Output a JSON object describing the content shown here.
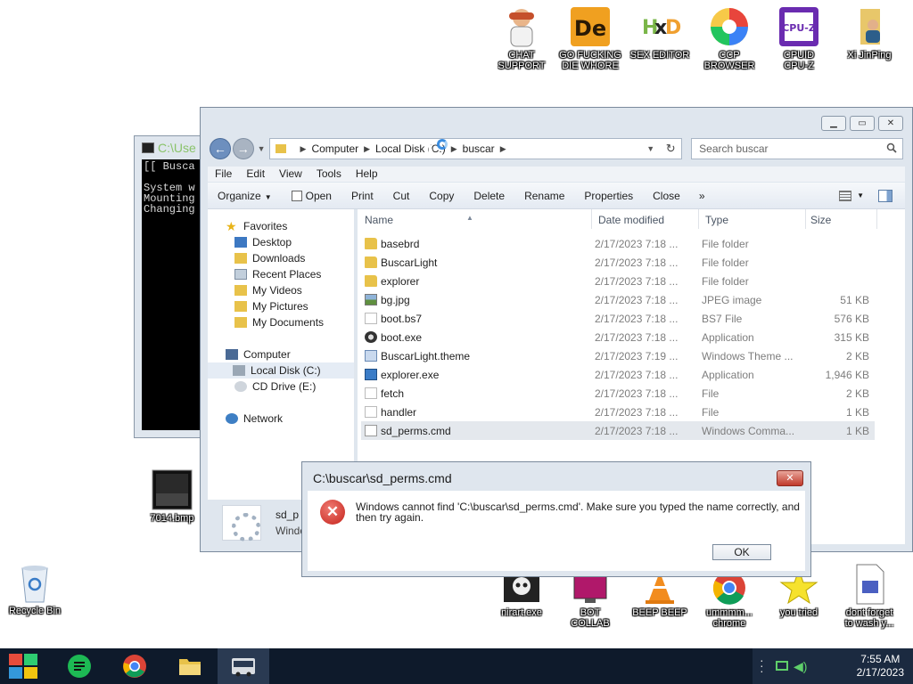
{
  "desktop_icons": {
    "chat_support": "CHAT\nSUPPORT",
    "go_die": "GO FUCKING\nDIE WHORE",
    "sex_editor": "SEX EDITOR",
    "ccp_browser": "CCP\nBROWSER",
    "cpuz": "CPUID\nCPU-Z",
    "xi": "Xi JinPing",
    "bmp": "7014.bmp",
    "recycle": "Recycle Bin",
    "nirart": "nirart.exe",
    "botcollab": "BOT\nCOLLAB",
    "beep": "BEEP BEEP",
    "chrome": "ummmm...\nchrome",
    "youtried": "you tried",
    "wash": "dont forget\nto wash y..."
  },
  "console": {
    "title": "C:\\Use",
    "lines": "[[ Busca\n\nSystem w\nMounting\nChanging"
  },
  "explorer": {
    "address": {
      "computer": "Computer",
      "local_disk": "Local Disk (C:)",
      "current": "buscar"
    },
    "search_placeholder": "Search buscar",
    "menu": {
      "file": "File",
      "edit": "Edit",
      "view": "View",
      "tools": "Tools",
      "help": "Help"
    },
    "toolbar": {
      "organize": "Organize",
      "open": "Open",
      "print": "Print",
      "cut": "Cut",
      "copy": "Copy",
      "delete": "Delete",
      "rename": "Rename",
      "properties": "Properties",
      "close": "Close",
      "more": "»"
    },
    "nav": {
      "favorites": "Favorites",
      "desktop": "Desktop",
      "downloads": "Downloads",
      "recent": "Recent Places",
      "videos": "My Videos",
      "pictures": "My Pictures",
      "documents": "My Documents",
      "computer": "Computer",
      "local_disk": "Local Disk (C:)",
      "cd_drive": "CD Drive (E:)",
      "network": "Network"
    },
    "columns": {
      "name": "Name",
      "date": "Date modified",
      "type": "Type",
      "size": "Size"
    },
    "files": [
      {
        "name": "basebrd",
        "date": "2/17/2023 7:18 ...",
        "type": "File folder",
        "size": ""
      },
      {
        "name": "BuscarLight",
        "date": "2/17/2023 7:18 ...",
        "type": "File folder",
        "size": ""
      },
      {
        "name": "explorer",
        "date": "2/17/2023 7:18 ...",
        "type": "File folder",
        "size": ""
      },
      {
        "name": "bg.jpg",
        "date": "2/17/2023 7:18 ...",
        "type": "JPEG image",
        "size": "51 KB"
      },
      {
        "name": "boot.bs7",
        "date": "2/17/2023 7:18 ...",
        "type": "BS7 File",
        "size": "576 KB"
      },
      {
        "name": "boot.exe",
        "date": "2/17/2023 7:18 ...",
        "type": "Application",
        "size": "315 KB"
      },
      {
        "name": "BuscarLight.theme",
        "date": "2/17/2023 7:19 ...",
        "type": "Windows Theme ...",
        "size": "2 KB"
      },
      {
        "name": "explorer.exe",
        "date": "2/17/2023 7:18 ...",
        "type": "Application",
        "size": "1,946 KB"
      },
      {
        "name": "fetch",
        "date": "2/17/2023 7:18 ...",
        "type": "File",
        "size": "2 KB"
      },
      {
        "name": "handler",
        "date": "2/17/2023 7:18 ...",
        "type": "File",
        "size": "1 KB"
      },
      {
        "name": "sd_perms.cmd",
        "date": "2/17/2023 7:18 ...",
        "type": "Windows Comma...",
        "size": "1 KB"
      }
    ],
    "details": {
      "name": "sd_p",
      "type": "Windo"
    }
  },
  "dialog": {
    "title": "C:\\buscar\\sd_perms.cmd",
    "message": "Windows cannot find 'C:\\buscar\\sd_perms.cmd'. Make sure you typed the name correctly, and then try again.",
    "ok": "OK",
    "close": "✕",
    "error_glyph": "✕"
  },
  "taskbar": {
    "time": "7:55 AM",
    "date": "2/17/2023"
  }
}
